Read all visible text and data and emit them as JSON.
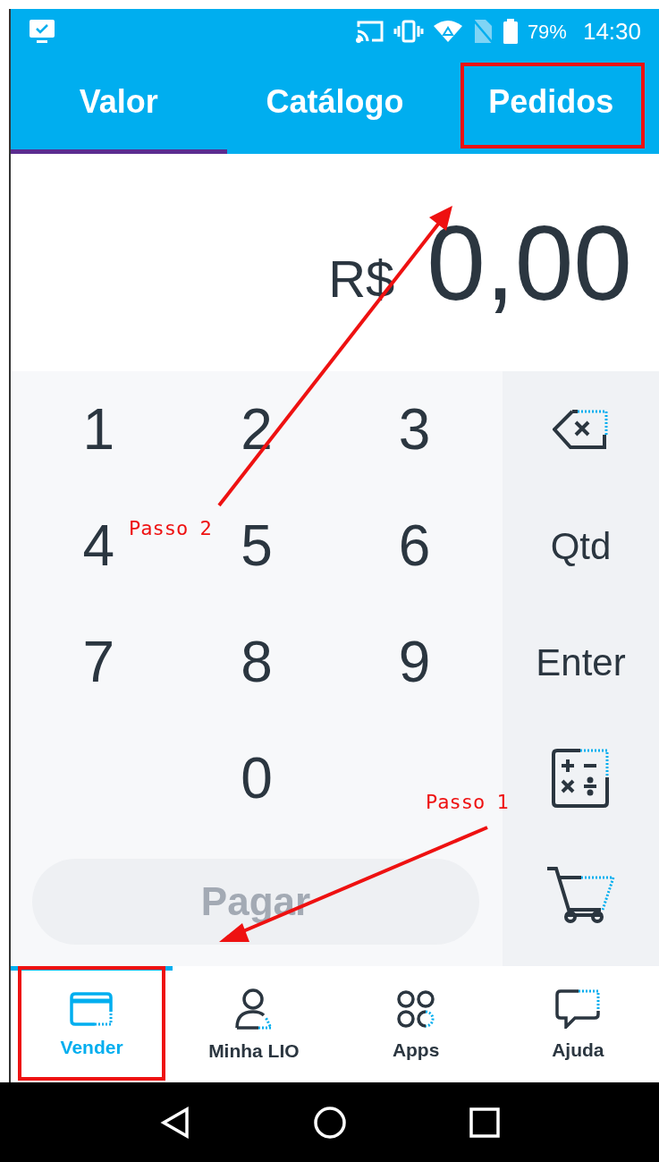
{
  "status_bar": {
    "battery": "79%",
    "time": "14:30"
  },
  "tabs": [
    {
      "label": "Valor",
      "selected": true,
      "highlighted": false
    },
    {
      "label": "Catálogo",
      "selected": false,
      "highlighted": false
    },
    {
      "label": "Pedidos",
      "selected": false,
      "highlighted": true
    }
  ],
  "amount": {
    "currency": "R$",
    "value": "0,00"
  },
  "keypad": {
    "keys": [
      "1",
      "2",
      "3",
      "4",
      "5",
      "6",
      "7",
      "8",
      "9",
      "0"
    ]
  },
  "side_keys": [
    {
      "kind": "backspace"
    },
    {
      "kind": "text",
      "label": "Qtd"
    },
    {
      "kind": "text",
      "label": "Enter"
    },
    {
      "kind": "calculator"
    },
    {
      "kind": "cart"
    }
  ],
  "pay_button": {
    "label": "Pagar",
    "disabled": true
  },
  "bottom_nav": [
    {
      "kind": "card",
      "label": "Vender",
      "selected": true,
      "highlighted": true
    },
    {
      "kind": "person",
      "label": "Minha LIO",
      "selected": false,
      "highlighted": false
    },
    {
      "kind": "apps",
      "label": "Apps",
      "selected": false,
      "highlighted": false
    },
    {
      "kind": "chat",
      "label": "Ajuda",
      "selected": false,
      "highlighted": false
    }
  ],
  "annotations": [
    {
      "label": "Passo 2"
    },
    {
      "label": "Passo 1"
    }
  ]
}
